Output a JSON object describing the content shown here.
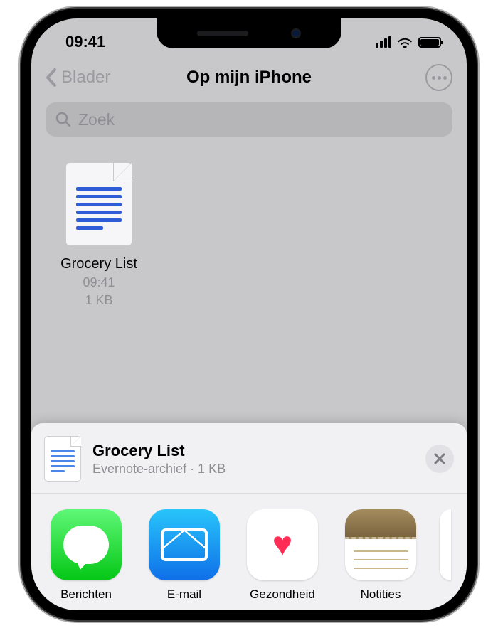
{
  "status": {
    "time": "09:41"
  },
  "nav": {
    "back_label": "Blader",
    "title": "Op mijn iPhone"
  },
  "search": {
    "placeholder": "Zoek"
  },
  "file": {
    "name": "Grocery List",
    "time": "09:41",
    "size": "1 KB"
  },
  "sheet": {
    "title": "Grocery List",
    "subtitle": "Evernote-archief · 1 KB",
    "apps": [
      {
        "label": "Berichten"
      },
      {
        "label": "E-mail"
      },
      {
        "label": "Gezondheid"
      },
      {
        "label": "Notities"
      }
    ]
  }
}
